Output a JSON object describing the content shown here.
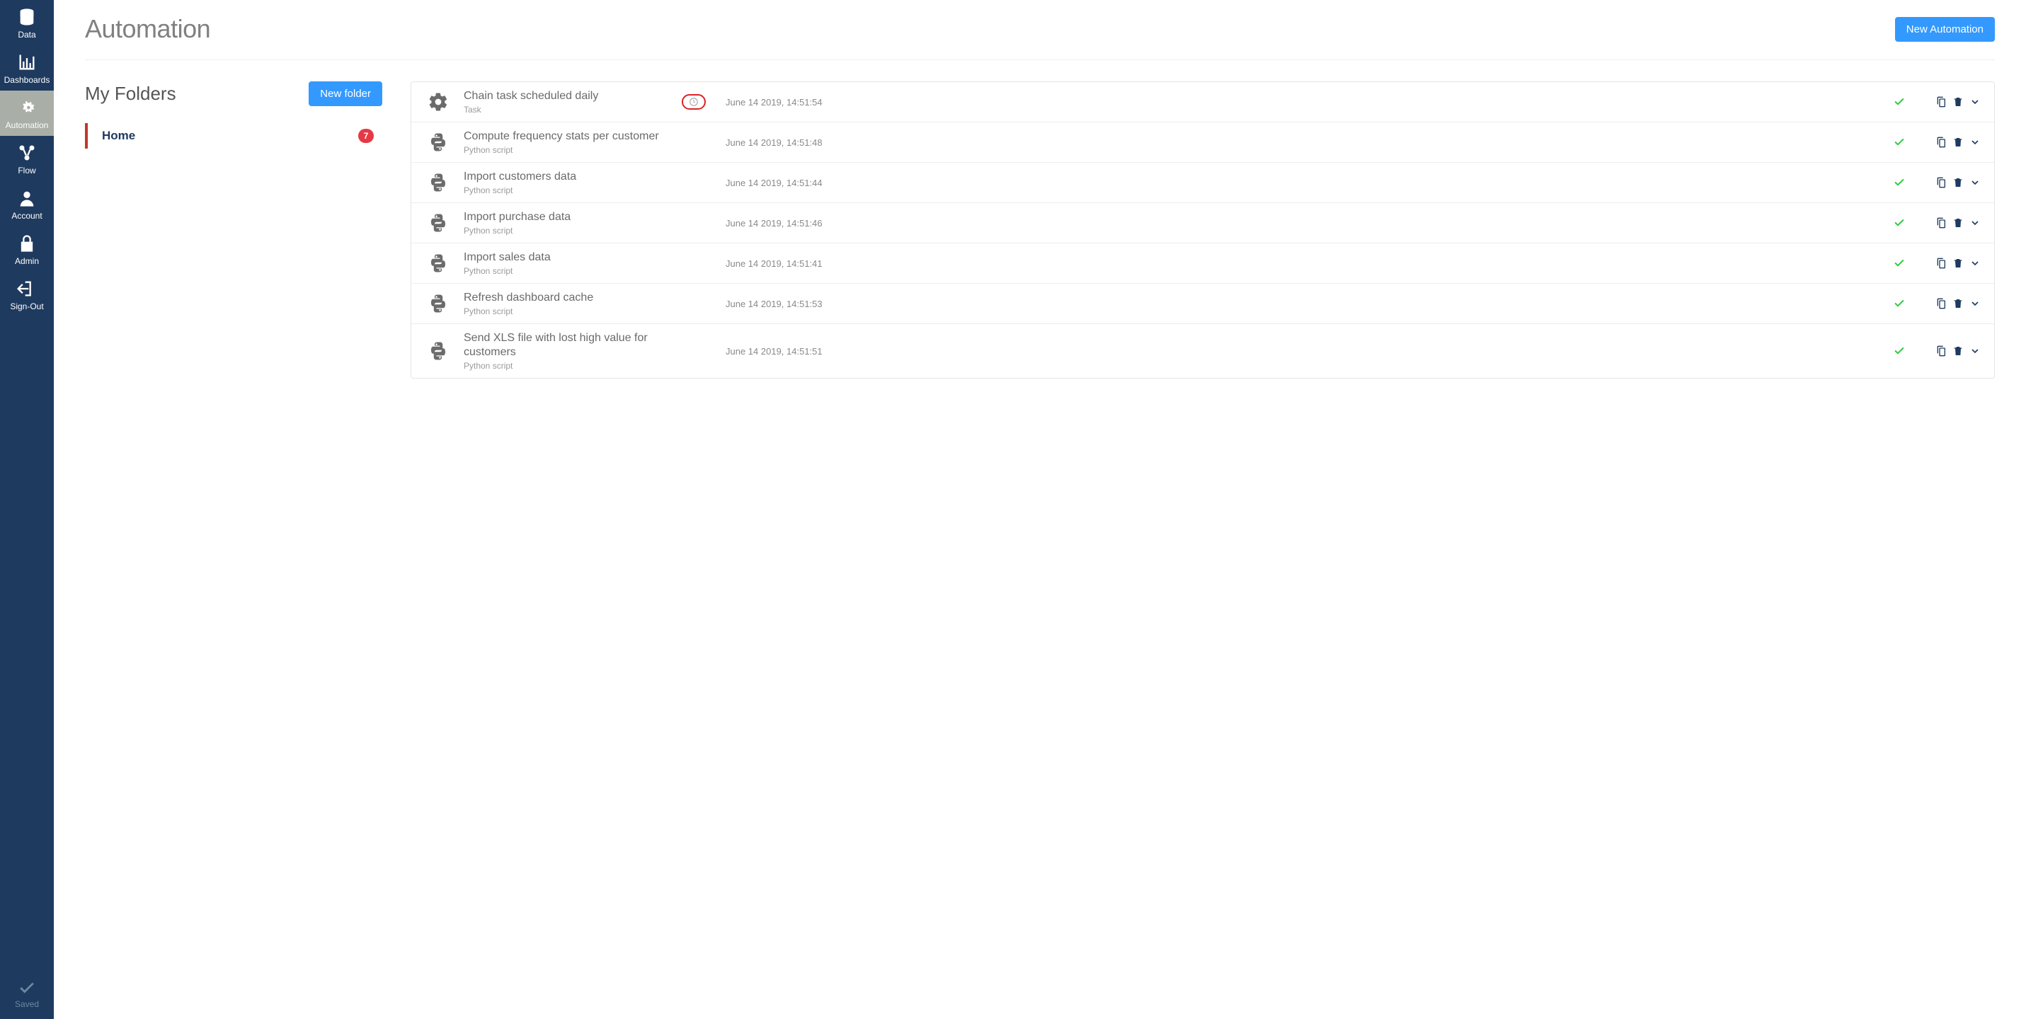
{
  "sidebar": {
    "items": [
      {
        "label": "Data",
        "icon": "data",
        "active": false
      },
      {
        "label": "Dashboards",
        "icon": "dashboards",
        "active": false
      },
      {
        "label": "Automation",
        "icon": "automation",
        "active": true
      },
      {
        "label": "Flow",
        "icon": "flow",
        "active": false
      },
      {
        "label": "Account",
        "icon": "account",
        "active": false
      },
      {
        "label": "Admin",
        "icon": "admin",
        "active": false
      },
      {
        "label": "Sign-Out",
        "icon": "signout",
        "active": false
      }
    ],
    "saved_label": "Saved"
  },
  "header": {
    "title": "Automation",
    "new_button": "New Automation"
  },
  "folders": {
    "title": "My Folders",
    "new_folder_button": "New folder",
    "items": [
      {
        "name": "Home",
        "count": 7
      }
    ]
  },
  "tasks": [
    {
      "icon": "gear",
      "title": "Chain task scheduled daily",
      "subtitle": "Task",
      "scheduled": true,
      "date": "June 14 2019, 14:51:54",
      "status": "ok"
    },
    {
      "icon": "python",
      "title": "Compute frequency stats per customer",
      "subtitle": "Python script",
      "scheduled": false,
      "date": "June 14 2019, 14:51:48",
      "status": "ok"
    },
    {
      "icon": "python",
      "title": "Import customers data",
      "subtitle": "Python script",
      "scheduled": false,
      "date": "June 14 2019, 14:51:44",
      "status": "ok"
    },
    {
      "icon": "python",
      "title": "Import purchase data",
      "subtitle": "Python script",
      "scheduled": false,
      "date": "June 14 2019, 14:51:46",
      "status": "ok"
    },
    {
      "icon": "python",
      "title": "Import sales data",
      "subtitle": "Python script",
      "scheduled": false,
      "date": "June 14 2019, 14:51:41",
      "status": "ok"
    },
    {
      "icon": "python",
      "title": "Refresh dashboard cache",
      "subtitle": "Python script",
      "scheduled": false,
      "date": "June 14 2019, 14:51:53",
      "status": "ok"
    },
    {
      "icon": "python",
      "title": "Send XLS file with lost high value for customers",
      "subtitle": "Python script",
      "scheduled": false,
      "date": "June 14 2019, 14:51:51",
      "status": "ok"
    }
  ],
  "icons": {
    "data": "database-icon",
    "dashboards": "bar-chart-icon",
    "automation": "gears-icon",
    "flow": "flow-icon",
    "account": "user-icon",
    "admin": "lock-icon",
    "signout": "sign-out-icon",
    "gear": "gear-icon",
    "python": "python-icon",
    "check": "check-icon",
    "copy": "copy-icon",
    "trash": "trash-icon",
    "chevron": "chevron-down-icon",
    "clock": "clock-icon"
  }
}
